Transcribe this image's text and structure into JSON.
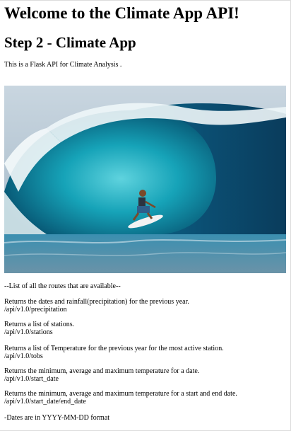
{
  "page": {
    "title": "Welcome to the Climate App API!",
    "subtitle": "Step 2 - Climate App",
    "intro": "This is a Flask API for Climate Analysis ."
  },
  "routes_header": "--List of all the routes that are available--",
  "routes": [
    {
      "description": "Returns the dates and rainfall(precipitation) for the previous year.",
      "path": "/api/v1.0/precipitation"
    },
    {
      "description": "Returns a list of stations.",
      "path": "/api/v1.0/stations"
    },
    {
      "description": "Returns a list of Temperature for the previous year for the most active station.",
      "path": "/api/v1.0/tobs"
    },
    {
      "description": "Returns the minimum, average and maximum temperature for a date.",
      "path": "/api/v1.0/start_date"
    },
    {
      "description": "Returns the minimum, average and maximum temperature for a start and end date.",
      "path": "/api/v1.0/start_date/end_date"
    }
  ],
  "footer_note": "-Dates are in YYYY-MM-DD format",
  "image": {
    "icon": "wave-surfer-image"
  }
}
